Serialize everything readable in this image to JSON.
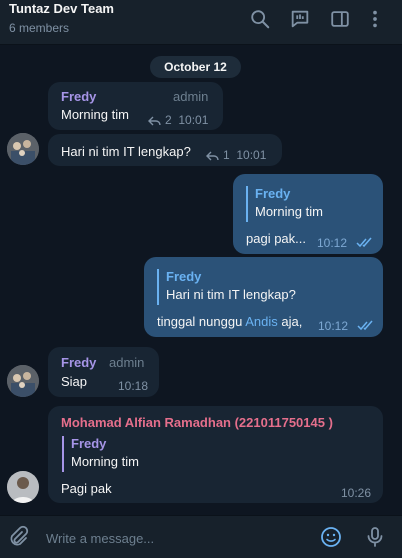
{
  "header": {
    "title": "Tuntaz Dev Team",
    "subtitle": "6 members",
    "icons": [
      "search-icon",
      "poll-icon",
      "sidebar-toggle-icon",
      "more-icon"
    ]
  },
  "date_separator": "October 12",
  "messages": [
    {
      "sender": "Fredy",
      "role": "admin",
      "text": "Morning tim",
      "replies": "2",
      "time": "10:01"
    },
    {
      "text": "Hari ni tim IT lengkap?",
      "replies": "1",
      "time": "10:01"
    },
    {
      "quote_sender": "Fredy",
      "quote_text": "Morning tim",
      "text": "pagi pak...",
      "time": "10:12"
    },
    {
      "quote_sender": "Fredy",
      "quote_text": "Hari ni tim IT lengkap?",
      "text_before": "tinggal nunggu ",
      "mention": "Andis",
      "text_after": " aja,",
      "time": "10:12"
    },
    {
      "sender": "Fredy",
      "role": "admin",
      "text": "Siap",
      "time": "10:18"
    },
    {
      "sender": "Mohamad Alfian Ramadhan (221011750145 )",
      "quote_sender": "Fredy",
      "quote_text": "Morning tim",
      "text": "Pagi pak",
      "time": "10:26"
    }
  ],
  "composer": {
    "placeholder": "Write a message..."
  },
  "colors": {
    "background": "#0e1621",
    "incoming": "#182533",
    "outgoing": "#2b5278",
    "accent": "#6ab2f2",
    "sender_fredy": "#a695e7",
    "sender_mohamad": "#e56f8c"
  }
}
